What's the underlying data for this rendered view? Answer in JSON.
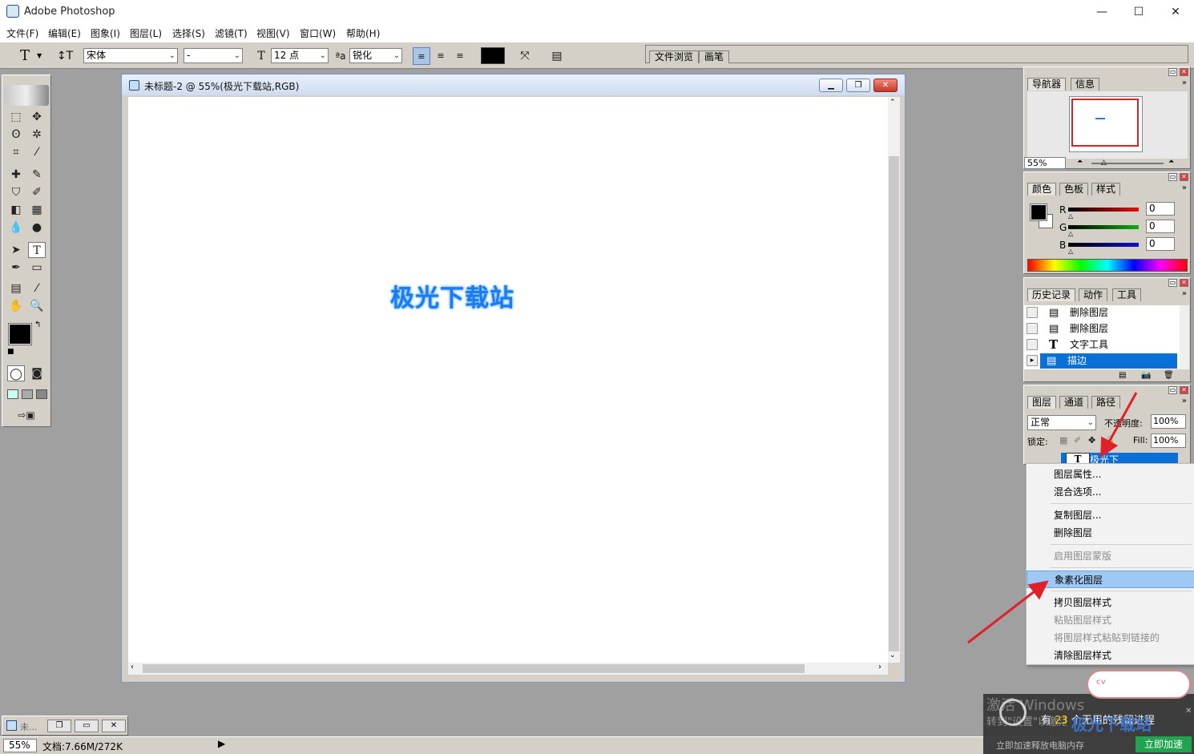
{
  "app": {
    "title": "Adobe Photoshop"
  },
  "window_controls": {
    "minimize": "—",
    "maximize": "☐",
    "close": "✕"
  },
  "menu": [
    "文件(F)",
    "编辑(E)",
    "图象(I)",
    "图层(L)",
    "选择(S)",
    "滤镜(T)",
    "视图(V)",
    "窗口(W)",
    "帮助(H)"
  ],
  "options": {
    "tool_glyph": "T",
    "font_family": "宋体",
    "font_style": "-",
    "font_size": "12 点",
    "aa_label": "ªa",
    "antialias": "锐化",
    "text_color": "#000000"
  },
  "browser_tabs": [
    "文件浏览",
    "画笔"
  ],
  "document": {
    "title": "未标题-2 @ 55%(极光下载站,RGB)",
    "canvas_text": "极光下载站"
  },
  "navigator": {
    "tabs": [
      "导航器",
      "信息"
    ],
    "zoom": "55%"
  },
  "color_panel": {
    "tabs": [
      "颜色",
      "色板",
      "样式"
    ],
    "channels": [
      {
        "label": "R",
        "value": "0",
        "color": "#e01010"
      },
      {
        "label": "G",
        "value": "0",
        "color": "#10b010"
      },
      {
        "label": "B",
        "value": "0",
        "color": "#1010d0"
      }
    ]
  },
  "history_panel": {
    "tabs": [
      "历史记录",
      "动作",
      "工具"
    ],
    "items": [
      {
        "label": "删除图层",
        "icon": "doc-icon",
        "selected": false
      },
      {
        "label": "删除图层",
        "icon": "doc-icon",
        "selected": false
      },
      {
        "label": "文字工具",
        "icon": "type-icon",
        "selected": false
      },
      {
        "label": "描边",
        "icon": "doc-icon",
        "selected": true
      }
    ]
  },
  "layers_panel": {
    "tabs": [
      "图层",
      "通道",
      "路径"
    ],
    "blend_mode": "正常",
    "opacity_label": "不透明度:",
    "opacity": "100%",
    "lock_label": "锁定:",
    "fill_label": "Fill:",
    "fill": "100%",
    "layer_name": "极光下"
  },
  "context_menu": [
    {
      "label": "图层属性...",
      "disabled": false
    },
    {
      "label": "混合选项...",
      "disabled": false
    },
    {
      "sep": true
    },
    {
      "label": "复制图层...",
      "disabled": false
    },
    {
      "label": "删除图层",
      "disabled": false
    },
    {
      "sep": true
    },
    {
      "label": "启用图层蒙版",
      "disabled": true
    },
    {
      "sep": true
    },
    {
      "label": "象素化图层",
      "disabled": false,
      "highlighted": true
    },
    {
      "sep": true
    },
    {
      "label": "拷贝图层样式",
      "disabled": false
    },
    {
      "label": "粘贴图层样式",
      "disabled": true
    },
    {
      "label": "将图层样式粘贴到链接的",
      "disabled": true
    },
    {
      "label": "清除图层样式",
      "disabled": false
    }
  ],
  "minimized_doc": {
    "label": "未..."
  },
  "status": {
    "zoom": "55%",
    "doc_info": "文档:7.66M/272K"
  },
  "notification": {
    "prefix": "有",
    "count": "23",
    "suffix": "个无用的残留进程",
    "activate_line1": "激活 Windows",
    "activate_line2": "转到\"设置\"以激活 Windows。",
    "hint": "立即加速释放电脑内存",
    "button": "立即加速",
    "watermark": "极光下载站"
  },
  "colors": {
    "accent": "#1a7cf0",
    "selection": "#0a6fd6",
    "annotation_arrow": "#e0202a"
  }
}
